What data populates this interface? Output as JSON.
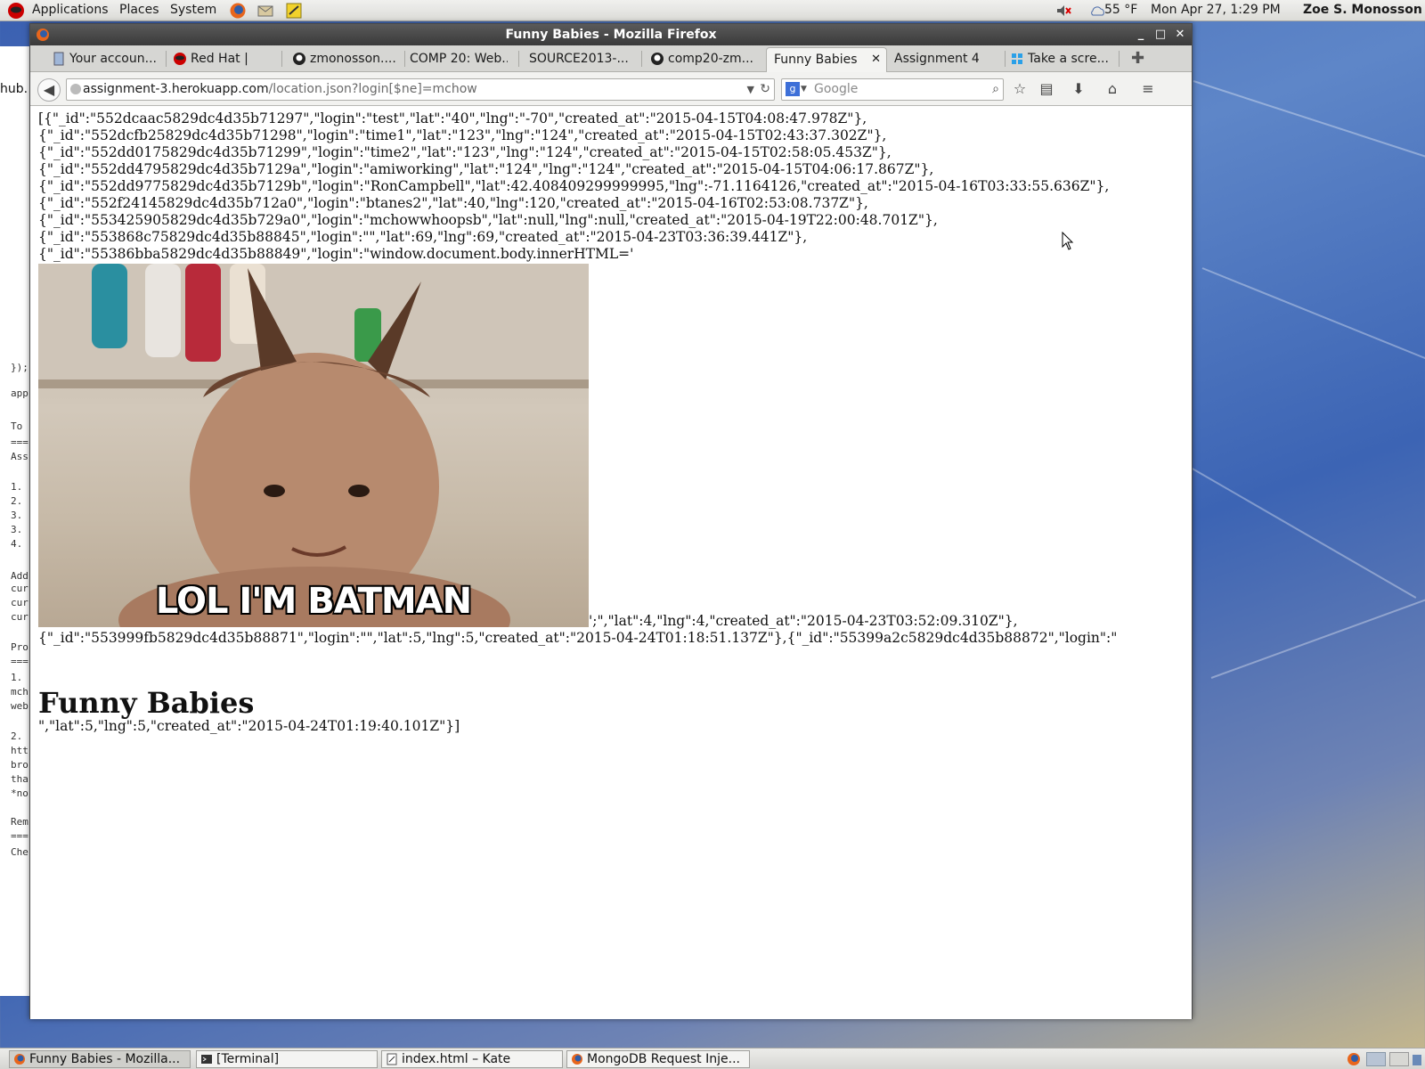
{
  "top_panel": {
    "menus": [
      "Applications",
      "Places",
      "System"
    ],
    "temperature": "55 °F",
    "clock": "Mon Apr 27,  1:29 PM",
    "user": "Zoe S. Monosson"
  },
  "bg_window": {
    "lines": [
      "app",
      "To",
      "===",
      "Ass",
      "1.",
      "2.",
      "3.",
      "3.",
      "4.",
      "Add",
      "cur",
      "cur",
      "cur",
      "Pro",
      "===",
      "1.",
      "mch",
      "web",
      "2.",
      "htt",
      "bro",
      "tha",
      "*no",
      "Rem",
      "===",
      "Che",
      "});"
    ]
  },
  "firefox": {
    "title": "Funny Babies - Mozilla Firefox",
    "tabs": [
      {
        "label": "Your accoun..."
      },
      {
        "label": "Red Hat |"
      },
      {
        "label": "zmonosson...."
      },
      {
        "label": "COMP 20: Web..."
      },
      {
        "label": "SOURCE2013-..."
      },
      {
        "label": "comp20-zm..."
      },
      {
        "label": "Funny Babies"
      },
      {
        "label": "Assignment 4"
      },
      {
        "label": "Take a scre..."
      }
    ],
    "url_host": "assignment-3.herokuapp.com",
    "url_path": "/location.json?login[$ne]=mchow",
    "search_placeholder": "Google",
    "hub_fragment": "hub."
  },
  "page": {
    "json_lines": [
      "[{\"_id\":\"552dcaac5829dc4d35b71297\",\"login\":\"test\",\"lat\":\"40\",\"lng\":\"-70\",\"created_at\":\"2015-04-15T04:08:47.978Z\"},",
      "{\"_id\":\"552dcfb25829dc4d35b71298\",\"login\":\"time1\",\"lat\":\"123\",\"lng\":\"124\",\"created_at\":\"2015-04-15T02:43:37.302Z\"},",
      "{\"_id\":\"552dd0175829dc4d35b71299\",\"login\":\"time2\",\"lat\":\"123\",\"lng\":\"124\",\"created_at\":\"2015-04-15T02:58:05.453Z\"},",
      "{\"_id\":\"552dd4795829dc4d35b7129a\",\"login\":\"amiworking\",\"lat\":\"124\",\"lng\":\"124\",\"created_at\":\"2015-04-15T04:06:17.867Z\"},",
      "{\"_id\":\"552dd9775829dc4d35b7129b\",\"login\":\"RonCampbell\",\"lat\":42.408409299999995,\"lng\":-71.1164126,\"created_at\":\"2015-04-16T03:33:55.636Z\"},",
      "{\"_id\":\"552f24145829dc4d35b712a0\",\"login\":\"btanes2\",\"lat\":40,\"lng\":120,\"created_at\":\"2015-04-16T02:53:08.737Z\"},",
      "{\"_id\":\"553425905829dc4d35b729a0\",\"login\":\"mchowwhoopsb\",\"lat\":null,\"lng\":null,\"created_at\":\"2015-04-19T22:00:48.701Z\"},",
      "{\"_id\":\"553868c75829dc4d35b88845\",\"login\":\"\",\"lat\":69,\"lng\":69,\"created_at\":\"2015-04-23T03:36:39.441Z\"},",
      "{\"_id\":\"55386bba5829dc4d35b88849\",\"login\":\"window.document.body.innerHTML='"
    ],
    "after_image": "';\",\"lat\":4,\"lng\":4,\"created_at\":\"2015-04-23T03:52:09.310Z\"},",
    "line_after": "{\"_id\":\"553999fb5829dc4d35b88871\",\"login\":\"\",\"lat\":5,\"lng\":5,\"created_at\":\"2015-04-24T01:18:51.137Z\"},{\"_id\":\"55399a2c5829dc4d35b88872\",\"login\":\"",
    "heading": "Funny Babies",
    "tail": "\",\"lat\":5,\"lng\":5,\"created_at\":\"2015-04-24T01:19:40.101Z\"}]",
    "meme_caption": "LOL I'M BATMAN"
  },
  "taskbar": {
    "tasks": [
      {
        "label": "Funny Babies - Mozilla..."
      },
      {
        "label": "[Terminal]"
      },
      {
        "label": "index.html – Kate"
      },
      {
        "label": "MongoDB Request Inje..."
      }
    ]
  }
}
